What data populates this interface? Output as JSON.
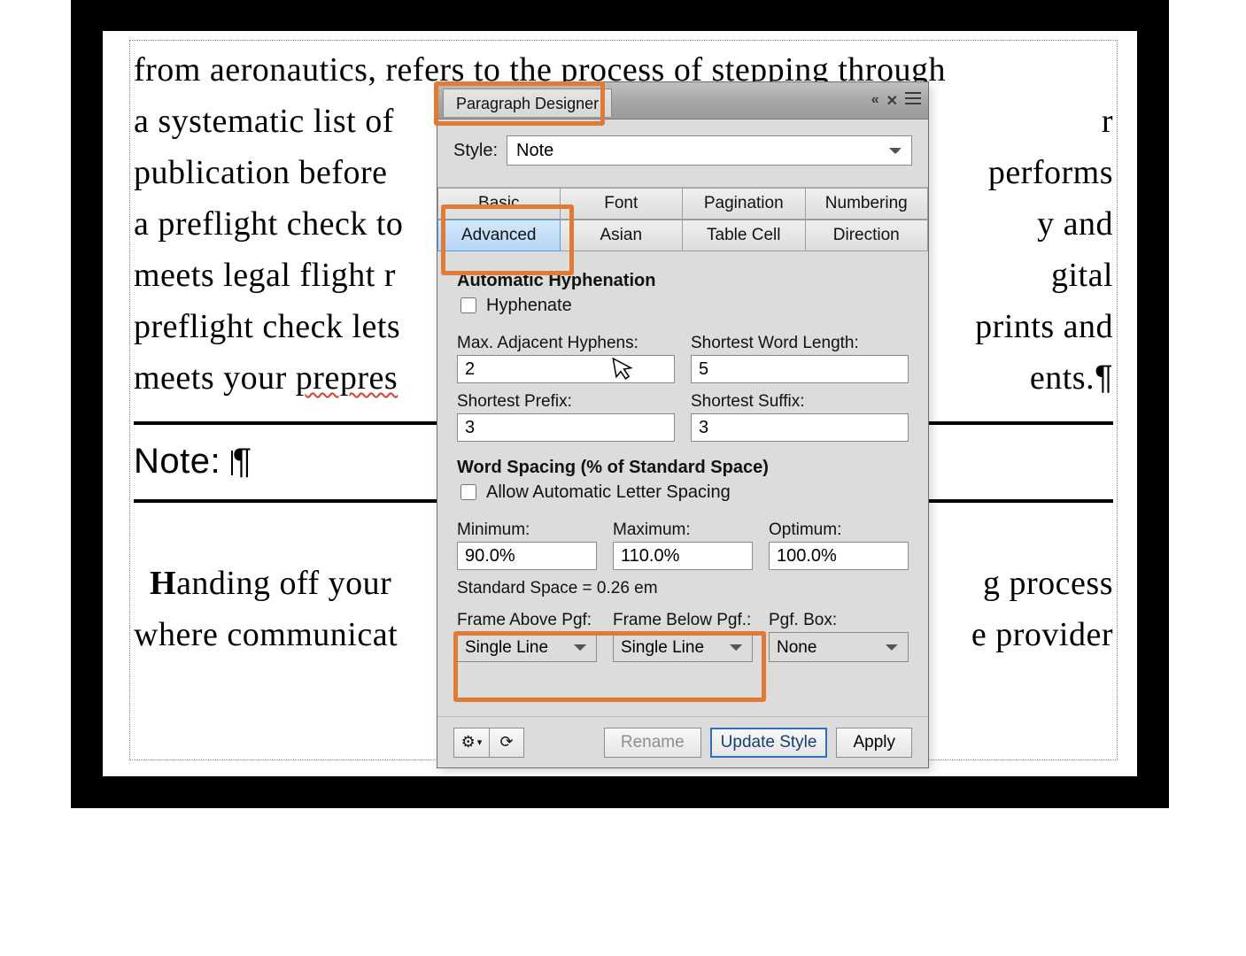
{
  "doc": {
    "line1": "from aeronautics, refers to the process of stepping through",
    "line2_a": "a systematic list of ",
    "line2_b": "r",
    "line3_a": "publication before ",
    "line3_b": " performs",
    "line4_a": "a preflight check to",
    "line4_b": "y and",
    "line5_a": "meets legal flight r",
    "line5_b": "gital",
    "line6_a": "preflight check lets",
    "line6_b": "prints and",
    "line7_a": "meets your ",
    "line7_spell": "prepres",
    "line7_b": "ents.",
    "note_prefix": "Note: ",
    "line8_a_initial": "H",
    "line8_a": "anding off your",
    "line8_b": "g process",
    "line9_a": "where communicat",
    "line9_b": "e provider"
  },
  "panel": {
    "title": "Paragraph Designer",
    "collapse": "«",
    "close": "✕",
    "style_label": "Style:",
    "style_value": "Note",
    "tabs": {
      "basic": "Basic",
      "font": "Font",
      "pagination": "Pagination",
      "numbering": "Numbering",
      "advanced": "Advanced",
      "asian": "Asian",
      "tablecell": "Table Cell",
      "direction": "Direction"
    },
    "hyph": {
      "section": "Automatic Hyphenation",
      "hyphenate_label": "Hyphenate",
      "max_adj_label": "Max. Adjacent Hyphens:",
      "max_adj_val": "2",
      "short_word_label": "Shortest Word Length:",
      "short_word_val": "5",
      "short_prefix_label": "Shortest Prefix:",
      "short_prefix_val": "3",
      "short_suffix_label": "Shortest Suffix:",
      "short_suffix_val": "3"
    },
    "ws": {
      "section": "Word Spacing (% of Standard Space)",
      "allow_label": "Allow Automatic Letter Spacing",
      "min_label": "Minimum:",
      "min_val": "90.0%",
      "max_label": "Maximum:",
      "max_val": "110.0%",
      "opt_label": "Optimum:",
      "opt_val": "100.0%",
      "std_space": "Standard Space = 0.26 em"
    },
    "frame": {
      "above_label": "Frame Above Pgf:",
      "above_val": "Single Line",
      "below_label": "Frame Below Pgf.:",
      "below_val": "Single Line",
      "box_label": "Pgf. Box:",
      "box_val": "None"
    },
    "footer": {
      "gear": "⚙",
      "refresh": "⟳",
      "rename": "Rename",
      "update": "Update Style",
      "apply": "Apply"
    }
  },
  "glyph": {
    "pilcrow": "¶"
  }
}
